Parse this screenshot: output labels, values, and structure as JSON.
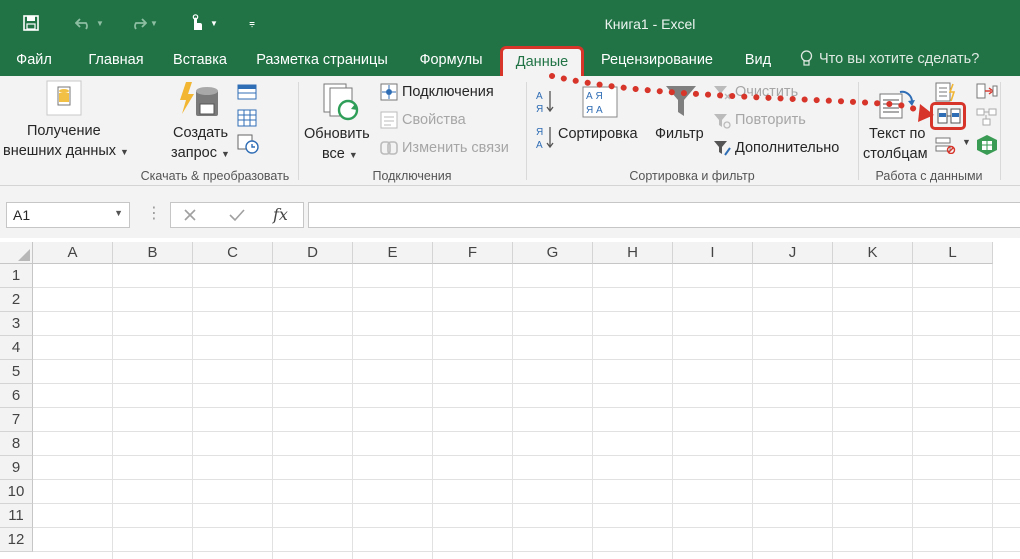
{
  "window": {
    "title": "Книга1 - Excel"
  },
  "tabs": [
    {
      "label": "Файл"
    },
    {
      "label": "Главная"
    },
    {
      "label": "Вставка"
    },
    {
      "label": "Разметка страницы"
    },
    {
      "label": "Формулы"
    },
    {
      "label": "Данные"
    },
    {
      "label": "Рецензирование"
    },
    {
      "label": "Вид"
    }
  ],
  "tell_me": "Что вы хотите сделать?",
  "ribbon": {
    "get_external": {
      "line1": "Получение",
      "line2": "внешних данных"
    },
    "create_query": {
      "line1": "Создать",
      "line2": "запрос"
    },
    "group1_label": "Скачать & преобразовать",
    "refresh": {
      "line1": "Обновить",
      "line2": "все"
    },
    "connections": "Подключения",
    "properties": "Свойства",
    "edit_links": "Изменить связи",
    "group2_label": "Подключения",
    "sort": "Сортировка",
    "filter": "Фильтр",
    "clear": "Очистить",
    "reapply": "Повторить",
    "advanced": "Дополнительно",
    "group3_label": "Сортировка и фильтр",
    "text_to_columns": {
      "line1": "Текст по",
      "line2": "столбцам"
    },
    "group4_label": "Работа с данными",
    "sort_az_top": "А",
    "sort_az_bottom": "Я",
    "sort_big_top": "А Я",
    "sort_big_bottom": "Я А"
  },
  "formula_bar": {
    "name_box": "A1",
    "fx": "fx",
    "value": ""
  },
  "columns": [
    "A",
    "B",
    "C",
    "D",
    "E",
    "F",
    "G",
    "H",
    "I",
    "J",
    "K",
    "L"
  ],
  "rows": [
    "1",
    "2",
    "3",
    "4",
    "5",
    "6",
    "7",
    "8",
    "9",
    "10",
    "11",
    "12"
  ],
  "colors": {
    "excel_green": "#217346",
    "highlight_red": "#d7342a"
  }
}
